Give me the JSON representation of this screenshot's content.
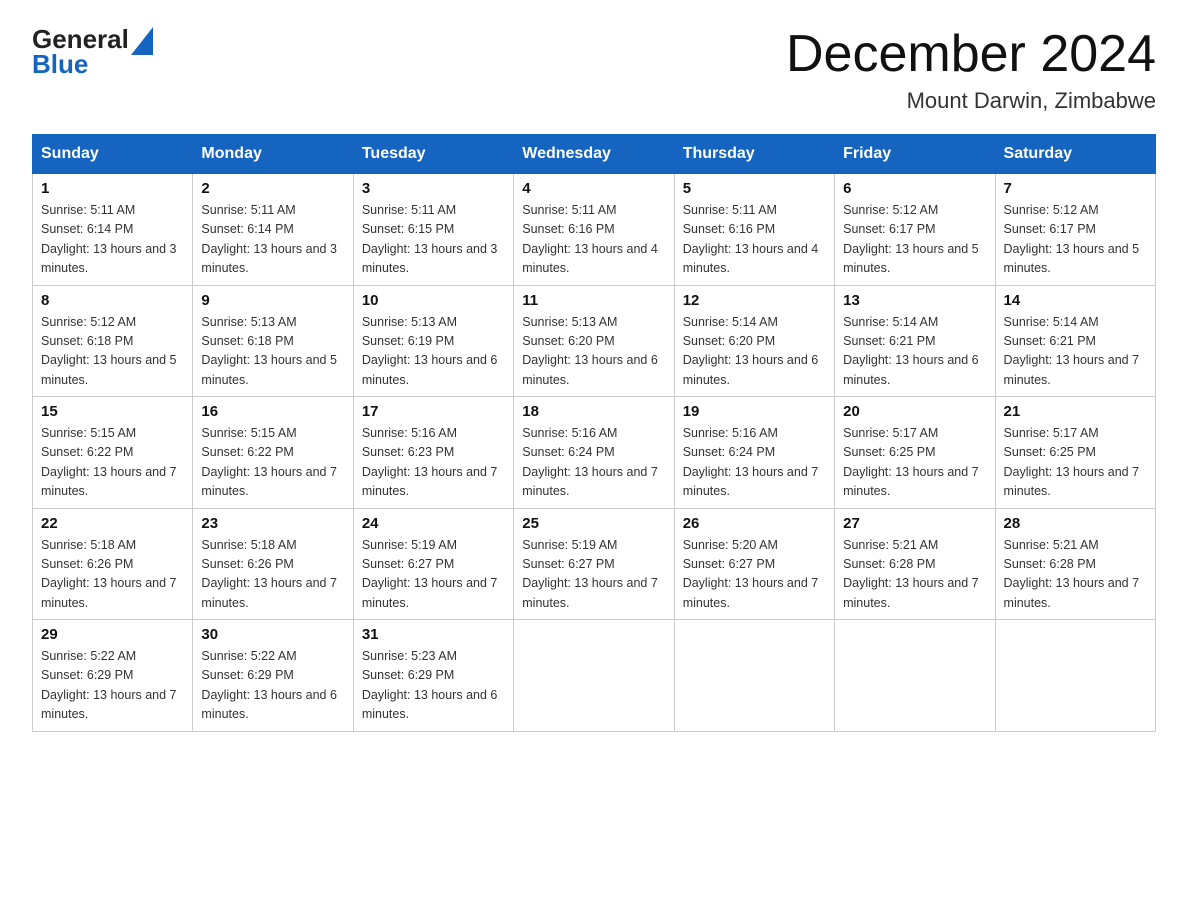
{
  "logo": {
    "general": "General",
    "blue": "Blue"
  },
  "title": "December 2024",
  "location": "Mount Darwin, Zimbabwe",
  "days_of_week": [
    "Sunday",
    "Monday",
    "Tuesday",
    "Wednesday",
    "Thursday",
    "Friday",
    "Saturday"
  ],
  "weeks": [
    [
      {
        "day": "1",
        "sunrise": "5:11 AM",
        "sunset": "6:14 PM",
        "daylight": "13 hours and 3 minutes."
      },
      {
        "day": "2",
        "sunrise": "5:11 AM",
        "sunset": "6:14 PM",
        "daylight": "13 hours and 3 minutes."
      },
      {
        "day": "3",
        "sunrise": "5:11 AM",
        "sunset": "6:15 PM",
        "daylight": "13 hours and 3 minutes."
      },
      {
        "day": "4",
        "sunrise": "5:11 AM",
        "sunset": "6:16 PM",
        "daylight": "13 hours and 4 minutes."
      },
      {
        "day": "5",
        "sunrise": "5:11 AM",
        "sunset": "6:16 PM",
        "daylight": "13 hours and 4 minutes."
      },
      {
        "day": "6",
        "sunrise": "5:12 AM",
        "sunset": "6:17 PM",
        "daylight": "13 hours and 5 minutes."
      },
      {
        "day": "7",
        "sunrise": "5:12 AM",
        "sunset": "6:17 PM",
        "daylight": "13 hours and 5 minutes."
      }
    ],
    [
      {
        "day": "8",
        "sunrise": "5:12 AM",
        "sunset": "6:18 PM",
        "daylight": "13 hours and 5 minutes."
      },
      {
        "day": "9",
        "sunrise": "5:13 AM",
        "sunset": "6:18 PM",
        "daylight": "13 hours and 5 minutes."
      },
      {
        "day": "10",
        "sunrise": "5:13 AM",
        "sunset": "6:19 PM",
        "daylight": "13 hours and 6 minutes."
      },
      {
        "day": "11",
        "sunrise": "5:13 AM",
        "sunset": "6:20 PM",
        "daylight": "13 hours and 6 minutes."
      },
      {
        "day": "12",
        "sunrise": "5:14 AM",
        "sunset": "6:20 PM",
        "daylight": "13 hours and 6 minutes."
      },
      {
        "day": "13",
        "sunrise": "5:14 AM",
        "sunset": "6:21 PM",
        "daylight": "13 hours and 6 minutes."
      },
      {
        "day": "14",
        "sunrise": "5:14 AM",
        "sunset": "6:21 PM",
        "daylight": "13 hours and 7 minutes."
      }
    ],
    [
      {
        "day": "15",
        "sunrise": "5:15 AM",
        "sunset": "6:22 PM",
        "daylight": "13 hours and 7 minutes."
      },
      {
        "day": "16",
        "sunrise": "5:15 AM",
        "sunset": "6:22 PM",
        "daylight": "13 hours and 7 minutes."
      },
      {
        "day": "17",
        "sunrise": "5:16 AM",
        "sunset": "6:23 PM",
        "daylight": "13 hours and 7 minutes."
      },
      {
        "day": "18",
        "sunrise": "5:16 AM",
        "sunset": "6:24 PM",
        "daylight": "13 hours and 7 minutes."
      },
      {
        "day": "19",
        "sunrise": "5:16 AM",
        "sunset": "6:24 PM",
        "daylight": "13 hours and 7 minutes."
      },
      {
        "day": "20",
        "sunrise": "5:17 AM",
        "sunset": "6:25 PM",
        "daylight": "13 hours and 7 minutes."
      },
      {
        "day": "21",
        "sunrise": "5:17 AM",
        "sunset": "6:25 PM",
        "daylight": "13 hours and 7 minutes."
      }
    ],
    [
      {
        "day": "22",
        "sunrise": "5:18 AM",
        "sunset": "6:26 PM",
        "daylight": "13 hours and 7 minutes."
      },
      {
        "day": "23",
        "sunrise": "5:18 AM",
        "sunset": "6:26 PM",
        "daylight": "13 hours and 7 minutes."
      },
      {
        "day": "24",
        "sunrise": "5:19 AM",
        "sunset": "6:27 PM",
        "daylight": "13 hours and 7 minutes."
      },
      {
        "day": "25",
        "sunrise": "5:19 AM",
        "sunset": "6:27 PM",
        "daylight": "13 hours and 7 minutes."
      },
      {
        "day": "26",
        "sunrise": "5:20 AM",
        "sunset": "6:27 PM",
        "daylight": "13 hours and 7 minutes."
      },
      {
        "day": "27",
        "sunrise": "5:21 AM",
        "sunset": "6:28 PM",
        "daylight": "13 hours and 7 minutes."
      },
      {
        "day": "28",
        "sunrise": "5:21 AM",
        "sunset": "6:28 PM",
        "daylight": "13 hours and 7 minutes."
      }
    ],
    [
      {
        "day": "29",
        "sunrise": "5:22 AM",
        "sunset": "6:29 PM",
        "daylight": "13 hours and 7 minutes."
      },
      {
        "day": "30",
        "sunrise": "5:22 AM",
        "sunset": "6:29 PM",
        "daylight": "13 hours and 6 minutes."
      },
      {
        "day": "31",
        "sunrise": "5:23 AM",
        "sunset": "6:29 PM",
        "daylight": "13 hours and 6 minutes."
      },
      null,
      null,
      null,
      null
    ]
  ]
}
